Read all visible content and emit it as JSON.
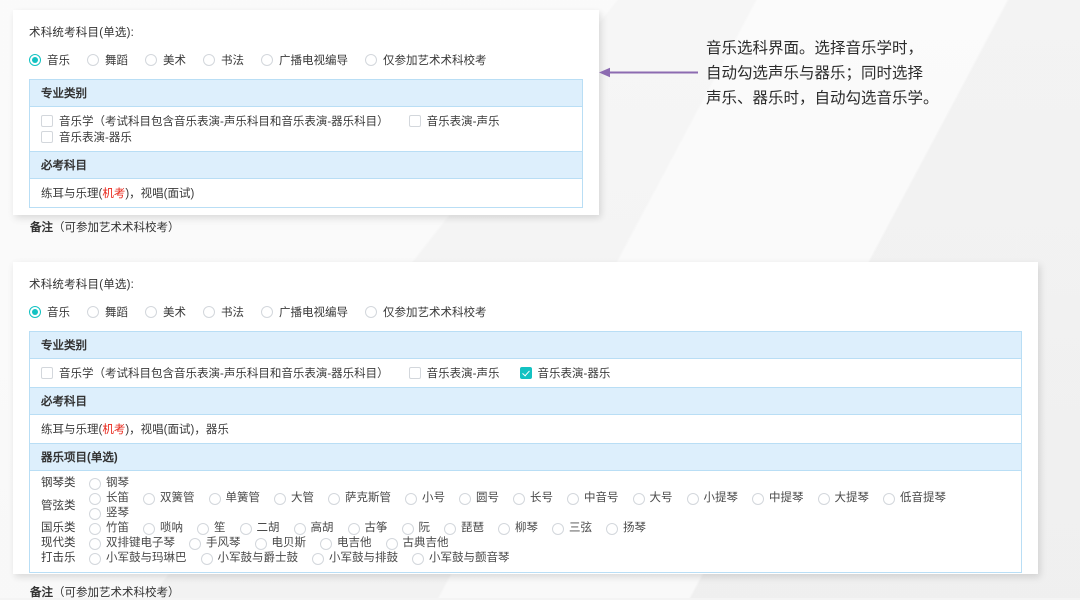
{
  "annotation": {
    "line1": "音乐选科界面。选择音乐学时，",
    "line2": "自动勾选声乐与器乐；同时选择",
    "line3": "声乐、器乐时，自动勾选音乐学。",
    "arrow_color": "#8c6bb1",
    "arrow_direction": "left"
  },
  "colors": {
    "accent_teal": "#13c2c2",
    "header_blue_bg": "#ddeffc",
    "border_blue": "#b9def5",
    "red_emphasis": "#e8271b",
    "panel_bg": "#ffffff",
    "page_bg": "#f4f4f4"
  },
  "panel_top": {
    "form_label": "术科统考科目(单选):",
    "subjects": [
      {
        "label": "音乐",
        "checked": true
      },
      {
        "label": "舞蹈",
        "checked": false
      },
      {
        "label": "美术",
        "checked": false
      },
      {
        "label": "书法",
        "checked": false
      },
      {
        "label": "广播电视编导",
        "checked": false
      },
      {
        "label": "仅参加艺术术科校考",
        "checked": false
      }
    ],
    "major_header": "专业类别",
    "majors": [
      {
        "label": "音乐学（考试科目包含音乐表演-声乐科目和音乐表演-器乐科目）",
        "checked": false
      },
      {
        "label": "音乐表演-声乐",
        "checked": false
      },
      {
        "label": "音乐表演-器乐",
        "checked": false
      }
    ],
    "required_header": "必考科目",
    "required_text_pre": "练耳与乐理(",
    "required_text_em": "机考",
    "required_text_post": ")，视唱(面试)",
    "remark_title": "备注",
    "remark_text": "（可参加艺术术科校考）"
  },
  "panel_bottom": {
    "form_label": "术科统考科目(单选):",
    "subjects": [
      {
        "label": "音乐",
        "checked": true
      },
      {
        "label": "舞蹈",
        "checked": false
      },
      {
        "label": "美术",
        "checked": false
      },
      {
        "label": "书法",
        "checked": false
      },
      {
        "label": "广播电视编导",
        "checked": false
      },
      {
        "label": "仅参加艺术术科校考",
        "checked": false
      }
    ],
    "major_header": "专业类别",
    "majors": [
      {
        "label": "音乐学（考试科目包含音乐表演-声乐科目和音乐表演-器乐科目）",
        "checked": false
      },
      {
        "label": "音乐表演-声乐",
        "checked": false
      },
      {
        "label": "音乐表演-器乐",
        "checked": true
      }
    ],
    "required_header": "必考科目",
    "required_text_pre": "练耳与乐理(",
    "required_text_em": "机考",
    "required_text_post": ")，视唱(面试)，器乐",
    "instrument_header": "器乐项目(单选)",
    "instrument_groups": [
      {
        "category": "钢琴类",
        "items": [
          {
            "label": "钢琴",
            "checked": false
          }
        ]
      },
      {
        "category": "管弦类",
        "items": [
          {
            "label": "长笛",
            "checked": false
          },
          {
            "label": "双簧管",
            "checked": false
          },
          {
            "label": "单簧管",
            "checked": false
          },
          {
            "label": "大管",
            "checked": false
          },
          {
            "label": "萨克斯管",
            "checked": false
          },
          {
            "label": "小号",
            "checked": false
          },
          {
            "label": "圆号",
            "checked": false
          },
          {
            "label": "长号",
            "checked": false
          },
          {
            "label": "中音号",
            "checked": false
          },
          {
            "label": "大号",
            "checked": false
          },
          {
            "label": "小提琴",
            "checked": false
          },
          {
            "label": "中提琴",
            "checked": false
          },
          {
            "label": "大提琴",
            "checked": false
          },
          {
            "label": "低音提琴",
            "checked": false
          },
          {
            "label": "竖琴",
            "checked": false
          }
        ]
      },
      {
        "category": "国乐类",
        "items": [
          {
            "label": "竹笛",
            "checked": false
          },
          {
            "label": "唢呐",
            "checked": false
          },
          {
            "label": "笙",
            "checked": false
          },
          {
            "label": "二胡",
            "checked": false
          },
          {
            "label": "高胡",
            "checked": false
          },
          {
            "label": "古筝",
            "checked": false
          },
          {
            "label": "阮",
            "checked": false
          },
          {
            "label": "琵琶",
            "checked": false
          },
          {
            "label": "柳琴",
            "checked": false
          },
          {
            "label": "三弦",
            "checked": false
          },
          {
            "label": "扬琴",
            "checked": false
          }
        ]
      },
      {
        "category": "现代类",
        "items": [
          {
            "label": "双排键电子琴",
            "checked": false
          },
          {
            "label": "手风琴",
            "checked": false
          },
          {
            "label": "电贝斯",
            "checked": false
          },
          {
            "label": "电吉他",
            "checked": false
          },
          {
            "label": "古典吉他",
            "checked": false
          }
        ]
      },
      {
        "category": "打击乐",
        "items": [
          {
            "label": "小军鼓与玛琳巴",
            "checked": false
          },
          {
            "label": "小军鼓与爵士鼓",
            "checked": false
          },
          {
            "label": "小军鼓与排鼓",
            "checked": false
          },
          {
            "label": "小军鼓与颤音琴",
            "checked": false
          }
        ]
      }
    ],
    "remark_title": "备注",
    "remark_text": "（可参加艺术术科校考）"
  }
}
